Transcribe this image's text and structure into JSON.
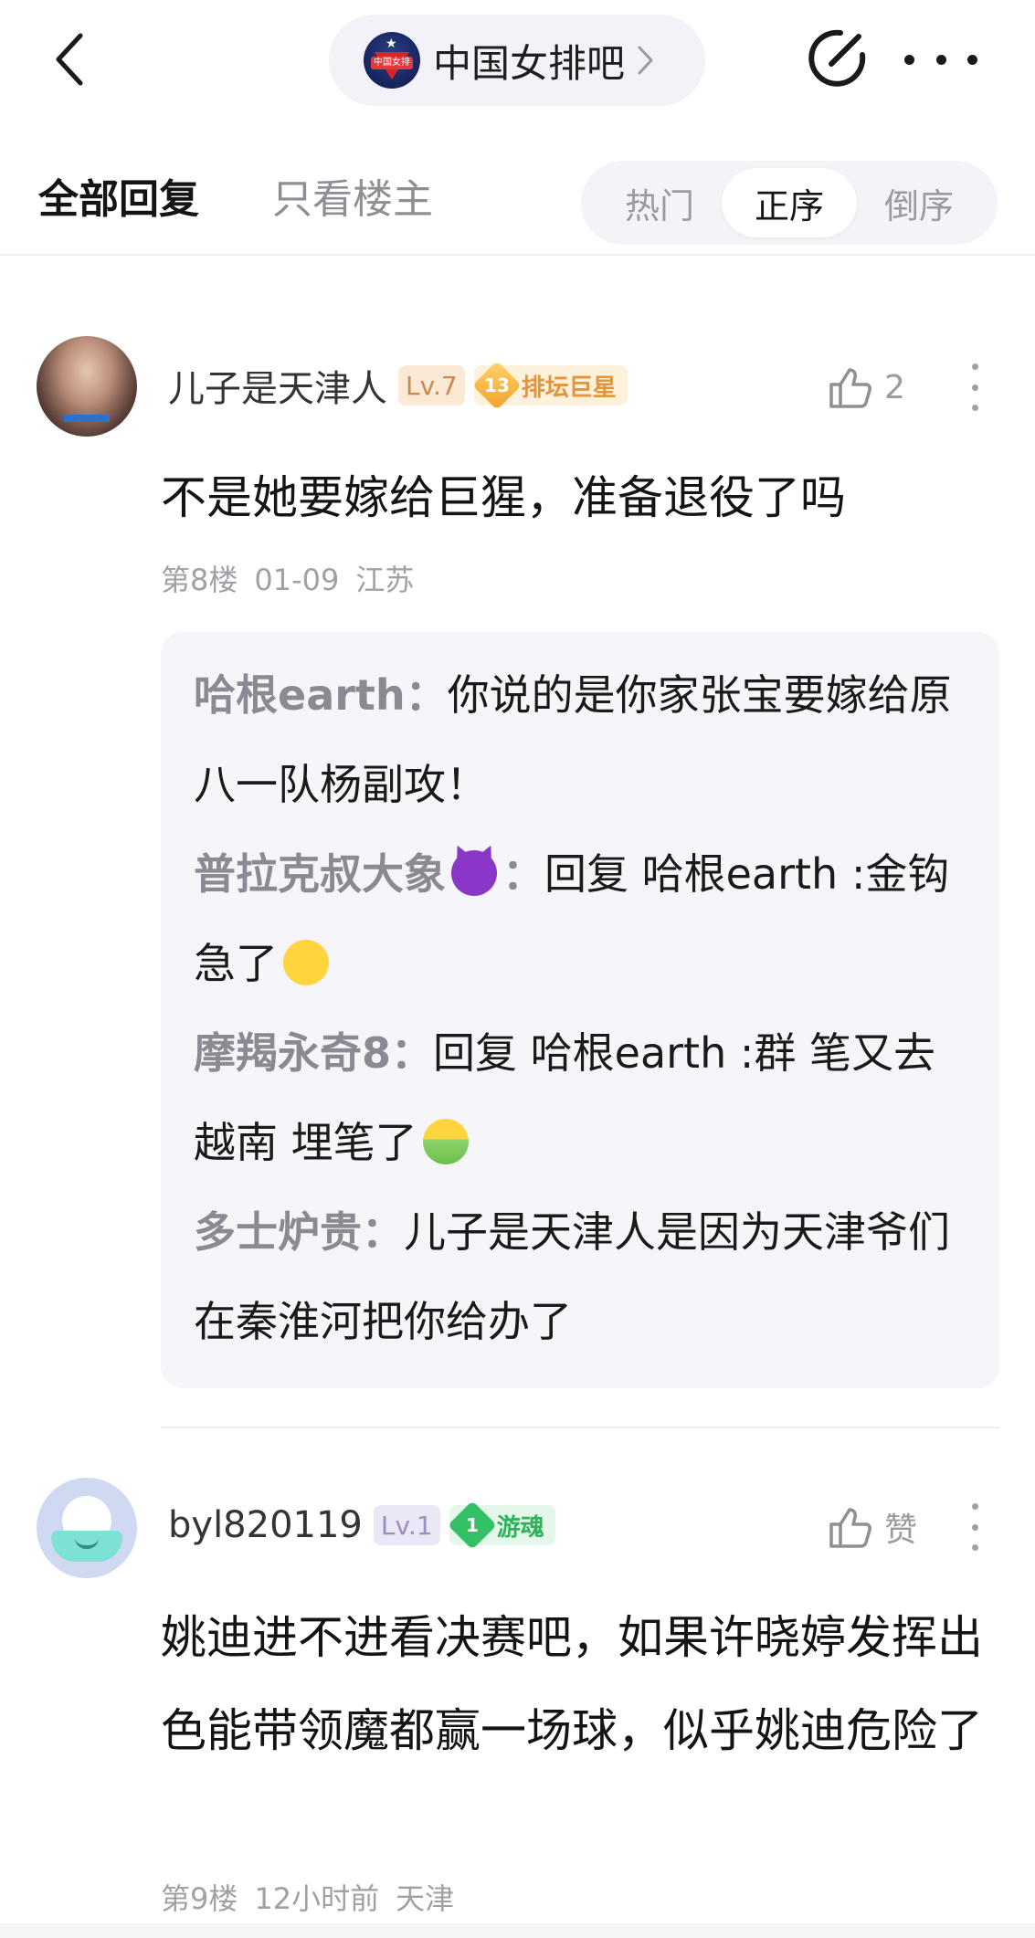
{
  "header": {
    "forum_name": "中国女排吧",
    "forum_logo_text": "中国女排"
  },
  "filter": {
    "tab_all": "全部回复",
    "tab_op_only": "只看楼主",
    "sort": [
      "热门",
      "正序",
      "倒序"
    ],
    "sort_active": "正序"
  },
  "posts": [
    {
      "username": "儿子是天津人",
      "level": "Lv.7",
      "title_num": "13",
      "title": "排坛巨星",
      "like_count": "2",
      "content": "不是她要嫁给巨猩，准备退役了吗",
      "floor": "第8楼",
      "date": "01-09",
      "location": "江苏",
      "replies": [
        {
          "name": "哈根earth：",
          "text": "你说的是你家张宝要嫁给原八一队杨副攻！"
        },
        {
          "name": "普拉克叔大象",
          "emoji": "devil-emoji",
          "name_suffix": "：",
          "text": "回复 哈根earth :金钩急了",
          "trail_emoji": "sneeze-emoji"
        },
        {
          "name": "摩羯永奇8：",
          "text": "回复 哈根earth :群 笔又去越南 埋笔了",
          "trail_emoji": "sick-emoji"
        },
        {
          "name": "多士炉贵：",
          "text": "儿子是天津人是因为天津爷们在秦淮河把你给办了"
        }
      ]
    },
    {
      "username": "byl820119",
      "level": "Lv.1",
      "title_num": "1",
      "title": "游魂",
      "like_label": "赞",
      "content": "姚迪进不进看决赛吧，如果许晓婷发挥出色能带领魔都赢一场球，似乎姚迪危险了",
      "floor": "第9楼",
      "date": "12小时前",
      "location": "天津"
    }
  ],
  "colors": {
    "accent_text": "#141414",
    "muted": "#a0a0a6",
    "reply_bg": "#f5f5fa",
    "level7": "#c98a4b",
    "title_gold": "#e2953a",
    "title_green": "#2eb35a"
  }
}
